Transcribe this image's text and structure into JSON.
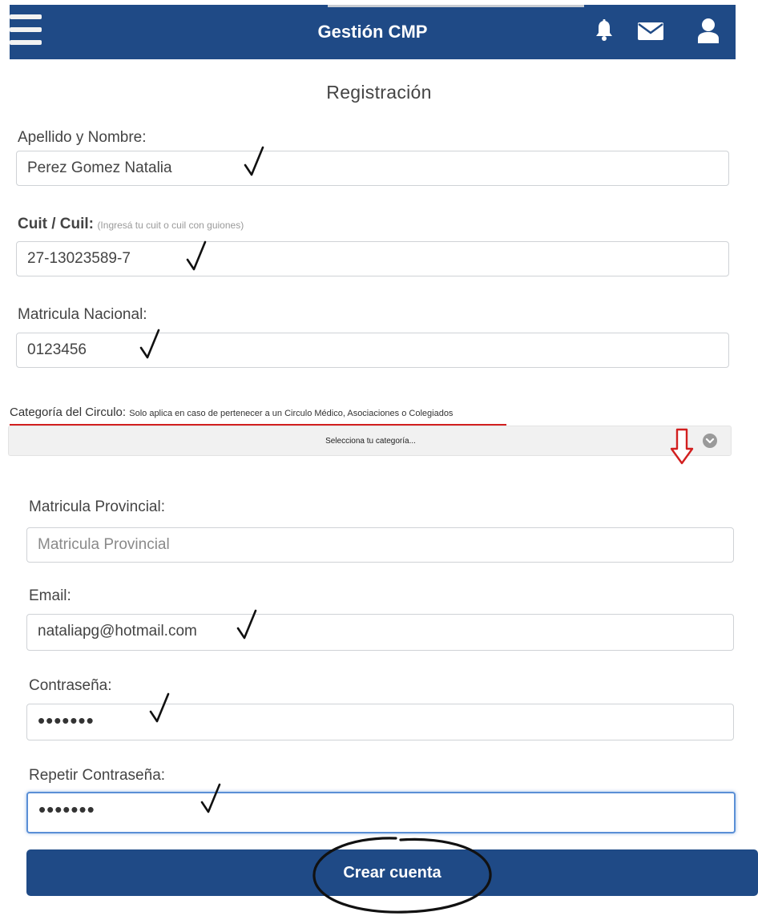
{
  "header": {
    "title": "Gestión CMP",
    "icons": [
      "menu-icon",
      "bell-icon",
      "mail-icon",
      "user-icon"
    ]
  },
  "page": {
    "title": "Registración"
  },
  "form": {
    "nombre": {
      "label": "Apellido y Nombre:",
      "value": "Perez Gomez Natalia"
    },
    "cuit": {
      "label": "Cuit / Cuil:",
      "hint": "(Ingresá tu cuit o cuil con guiones)",
      "value": "27-13023589-7"
    },
    "matricula_nacional": {
      "label": "Matricula Nacional:",
      "value": "0123456"
    },
    "categoria": {
      "label": "Categoría del Circulo:",
      "note": "Solo aplica en caso de pertenecer a un Circulo Médico, Asociaciones o Colegiados",
      "selected": "Selecciona tu categoría..."
    },
    "matricula_provincial": {
      "label": "Matricula Provincial:",
      "placeholder": "Matricula Provincial"
    },
    "email": {
      "label": "Email:",
      "value": "nataliapg@hotmail.com"
    },
    "password": {
      "label": "Contraseña:",
      "value": "•••••••"
    },
    "password_repeat": {
      "label": "Repetir Contraseña:",
      "value": "•••••••"
    },
    "submit_label": "Crear cuenta"
  },
  "colors": {
    "brand": "#1f4a86",
    "annotation_red": "#d21f1f",
    "focus": "#5a8fd6"
  }
}
